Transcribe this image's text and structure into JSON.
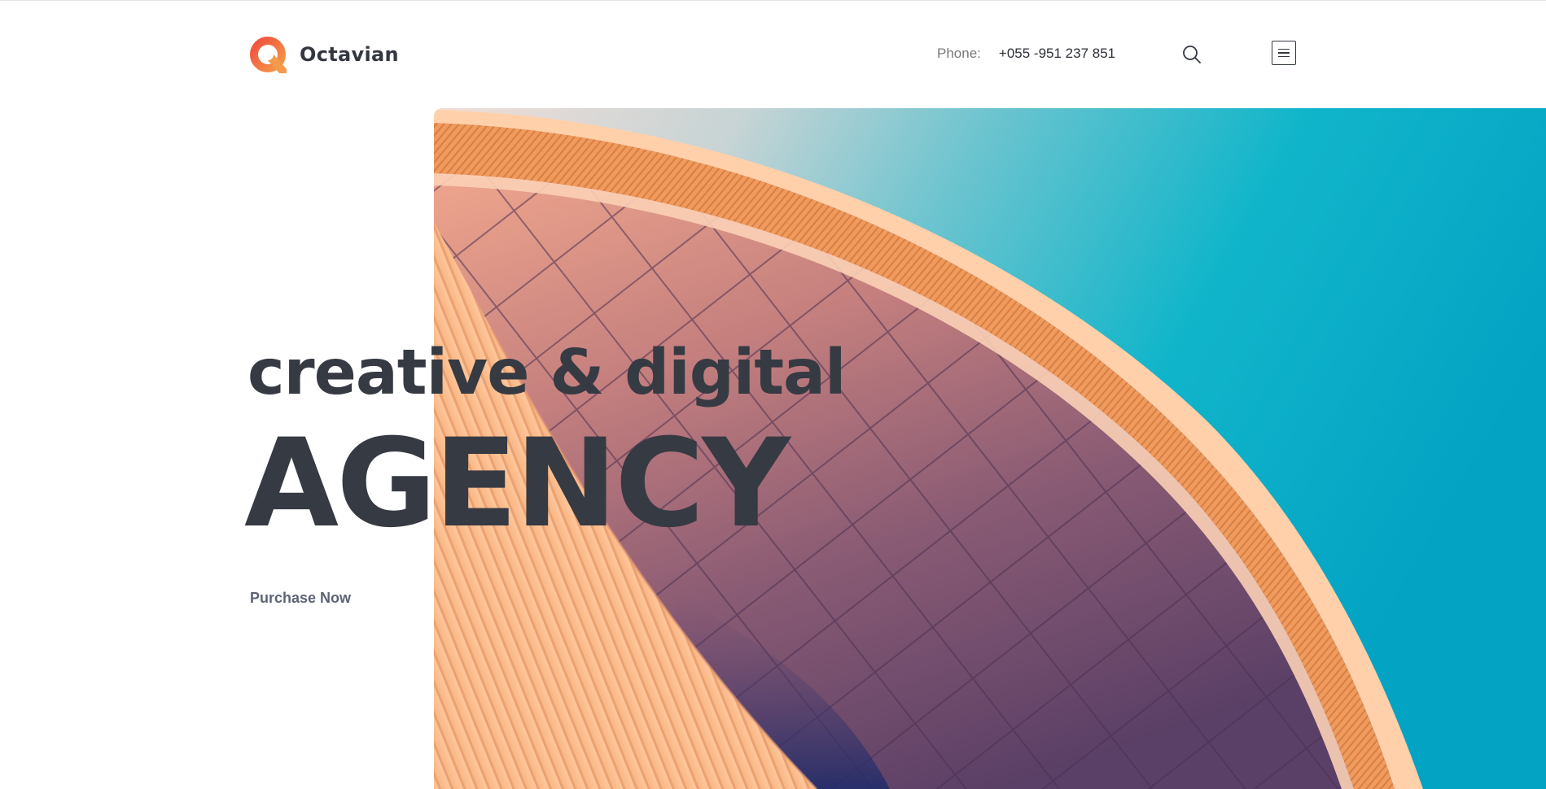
{
  "brand": {
    "name": "Octavian",
    "logo_icon": "octavian-logo-icon",
    "logo_colors": [
      "#f04e3e",
      "#f59a4a"
    ]
  },
  "header": {
    "phone_label": "Phone:",
    "phone_number": "+055 -951 237 851",
    "search_icon": "search-icon",
    "menu_icon": "hamburger-menu-icon"
  },
  "hero": {
    "subtitle": "creative & digital",
    "title": "AGENCY",
    "cta_label": "Purchase Now",
    "image_icon": "architecture-photo",
    "colors": {
      "text": "#363a43",
      "cta": "#5d6474",
      "sky": "#0fb1c9",
      "facade": "#f3a37d",
      "panels": "#8b5e78"
    }
  }
}
